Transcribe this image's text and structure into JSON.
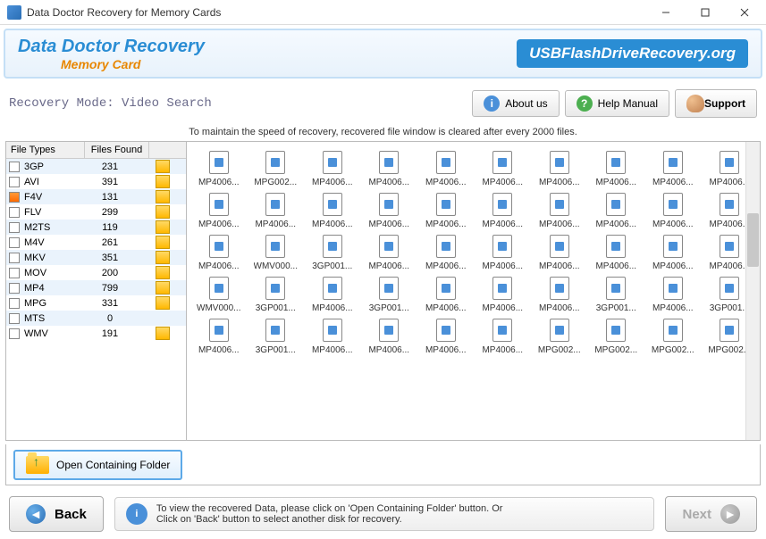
{
  "window": {
    "title": "Data Doctor Recovery for Memory Cards"
  },
  "header": {
    "app_title": "Data Doctor Recovery",
    "app_subtitle": "Memory Card",
    "site": "USBFlashDriveRecovery.org"
  },
  "toolbar": {
    "mode": "Recovery Mode: Video Search",
    "about": "About us",
    "help": "Help Manual",
    "support": "Support"
  },
  "info_strip": "To maintain the speed of recovery, recovered file window is cleared after every 2000 files.",
  "file_types": {
    "col1": "File Types",
    "col2": "Files Found",
    "rows": [
      {
        "name": "3GP",
        "count": 231,
        "bar": true
      },
      {
        "name": "AVI",
        "count": 391,
        "bar": true
      },
      {
        "name": "F4V",
        "count": 131,
        "bar": true
      },
      {
        "name": "FLV",
        "count": 299,
        "bar": true
      },
      {
        "name": "M2TS",
        "count": 119,
        "bar": true
      },
      {
        "name": "M4V",
        "count": 261,
        "bar": true
      },
      {
        "name": "MKV",
        "count": 351,
        "bar": true
      },
      {
        "name": "MOV",
        "count": 200,
        "bar": true
      },
      {
        "name": "MP4",
        "count": 799,
        "bar": true
      },
      {
        "name": "MPG",
        "count": 331,
        "bar": true
      },
      {
        "name": "MTS",
        "count": 0,
        "bar": false
      },
      {
        "name": "WMV",
        "count": 191,
        "bar": true
      }
    ]
  },
  "files": [
    "MP4006...",
    "MPG002...",
    "MP4006...",
    "MP4006...",
    "MP4006...",
    "MP4006...",
    "MP4006...",
    "MP4006...",
    "MP4006...",
    "MP4006...",
    "MP4006...",
    "MP4006...",
    "MP4006...",
    "MP4006...",
    "MP4006...",
    "MP4006...",
    "MP4006...",
    "MP4006...",
    "MP4006...",
    "MP4006...",
    "MP4006...",
    "WMV000...",
    "3GP001...",
    "MP4006...",
    "MP4006...",
    "MP4006...",
    "MP4006...",
    "MP4006...",
    "MP4006...",
    "MP4006...",
    "WMV000...",
    "3GP001...",
    "MP4006...",
    "3GP001...",
    "MP4006...",
    "MP4006...",
    "MP4006...",
    "3GP001...",
    "MP4006...",
    "3GP001...",
    "MP4006...",
    "3GP001...",
    "MP4006...",
    "MP4006...",
    "MP4006...",
    "MP4006...",
    "MPG002...",
    "MPG002...",
    "MPG002...",
    "MPG002..."
  ],
  "open_folder": "Open Containing Folder",
  "footer": {
    "info_line1": "To view the recovered Data, please click on 'Open Containing Folder' button. Or",
    "info_line2": "Click on 'Back' button to select another disk for recovery.",
    "back": "Back",
    "next": "Next"
  }
}
